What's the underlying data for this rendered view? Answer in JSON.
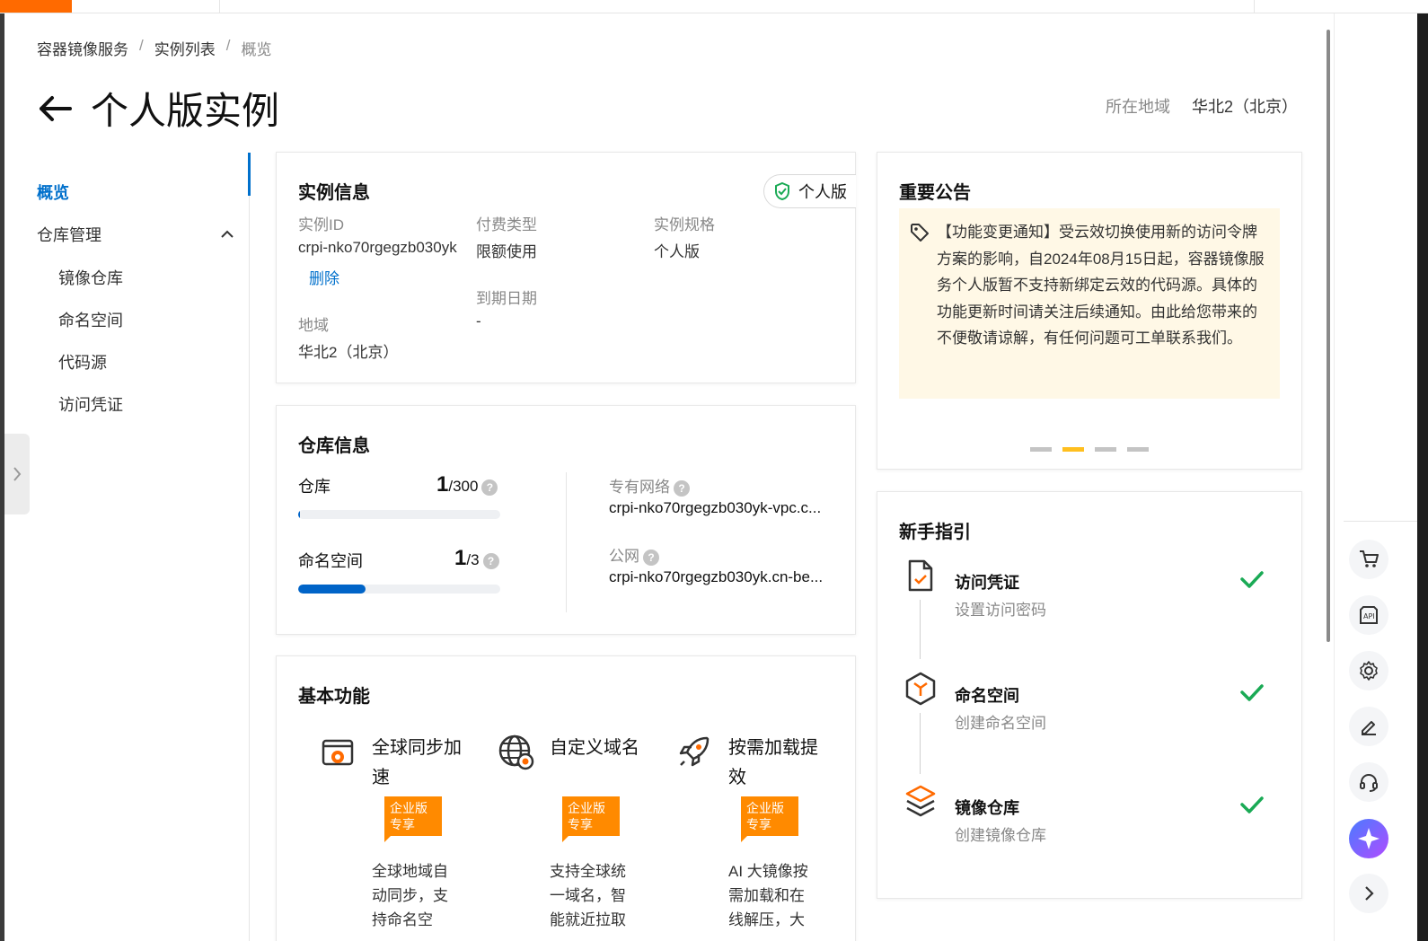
{
  "breadcrumb": [
    "容器镜像服务",
    "实例列表",
    "概览"
  ],
  "page": {
    "title": "个人版实例"
  },
  "region": {
    "label": "所在地域",
    "value": "华北2（北京）"
  },
  "sidenav": {
    "overview": "概览",
    "repo_mgmt": "仓库管理",
    "image_repo": "镜像仓库",
    "namespace": "命名空间",
    "code_source": "代码源",
    "access_cred": "访问凭证"
  },
  "instance_info": {
    "title": "实例信息",
    "badge": "个人版",
    "id_label": "实例ID",
    "id_value": "crpi-nko70rgegzb030yk",
    "delete": "删除",
    "pay_label": "付费类型",
    "pay_value": "限额使用",
    "spec_label": "实例规格",
    "spec_value": "个人版",
    "expire_label": "到期日期",
    "expire_value": "-",
    "region_label": "地域",
    "region_value": "华北2（北京）"
  },
  "repo_info": {
    "title": "仓库信息",
    "repo_label": "仓库",
    "repo_used": "1",
    "repo_total": "/300",
    "repo_fraction": 0.0033,
    "ns_label": "命名空间",
    "ns_used": "1",
    "ns_total": "/3",
    "ns_fraction": 0.333,
    "vpc_label": "专有网络",
    "vpc_value": "crpi-nko70rgegzb030yk-vpc.c...",
    "public_label": "公网",
    "public_value": "crpi-nko70rgegzb030yk.cn-be..."
  },
  "basic": {
    "title": "基本功能",
    "features": [
      {
        "title": "全球同步加速",
        "badge": "企业版专享",
        "desc": "全球地域自动同步，支持命名空"
      },
      {
        "title": "自定义域名",
        "badge": "企业版专享",
        "desc": "支持全球统一域名，智能就近拉取"
      },
      {
        "title": "按需加载提效",
        "badge": "企业版专享",
        "desc": "AI 大镜像按需加载和在线解压，大"
      }
    ]
  },
  "notice": {
    "title": "重要公告",
    "text": "【功能变更通知】受云效切换使用新的访问令牌方案的影响，自2024年08月15日起，容器镜像服务个人版暂不支持新绑定云效的代码源。具体的功能更新时间请关注后续通知。由此给您带来的不便敬请谅解，有任何问题可工单联系我们。",
    "active_dot": 1,
    "dot_count": 4
  },
  "guide": {
    "title": "新手指引",
    "steps": [
      {
        "title": "访问凭证",
        "sub": "设置访问密码"
      },
      {
        "title": "命名空间",
        "sub": "创建命名空间"
      },
      {
        "title": "镜像仓库",
        "sub": "创建镜像仓库"
      }
    ]
  },
  "colors": {
    "accent": "#0070cc",
    "orange": "#ff6a00",
    "check": "#1aaa55",
    "notice_bg": "#fff8e6"
  }
}
